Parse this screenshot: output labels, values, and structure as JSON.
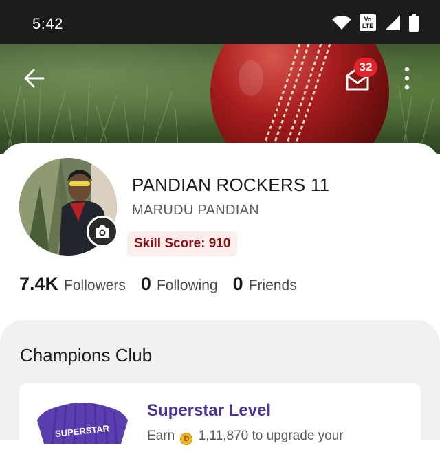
{
  "status_bar": {
    "time": "5:42",
    "icons": [
      "wifi-icon",
      "volte-icon",
      "signal-icon",
      "battery-icon"
    ],
    "volte_text": "Vo LTE"
  },
  "header": {
    "back_icon": "back-arrow-icon",
    "mail_icon": "mail-icon",
    "mail_badge": "32",
    "more_icon": "more-vertical-icon",
    "banner_image": "cricket-ball-on-grass"
  },
  "profile": {
    "team_name": "PANDIAN ROCKERS 11",
    "user_name": "MARUDU PANDIAN",
    "skill_score": "Skill Score: 910",
    "camera_icon": "camera-icon"
  },
  "stats": [
    {
      "value": "7.4K",
      "label": "Followers"
    },
    {
      "value": "0",
      "label": "Following"
    },
    {
      "value": "0",
      "label": "Friends"
    }
  ],
  "champions_club": {
    "title": "Champions Club",
    "level_title": "Superstar Level",
    "desc_prefix": "Earn",
    "desc_suffix": "1,11,870 to upgrade your",
    "jersey_text": "SUPERSTAR"
  },
  "colors": {
    "status_bar": "#1c1c1c",
    "badge_red": "#e0242b",
    "skill_text": "#8b1114",
    "skill_bg": "#fdeeee",
    "level_purple": "#4b3296"
  }
}
